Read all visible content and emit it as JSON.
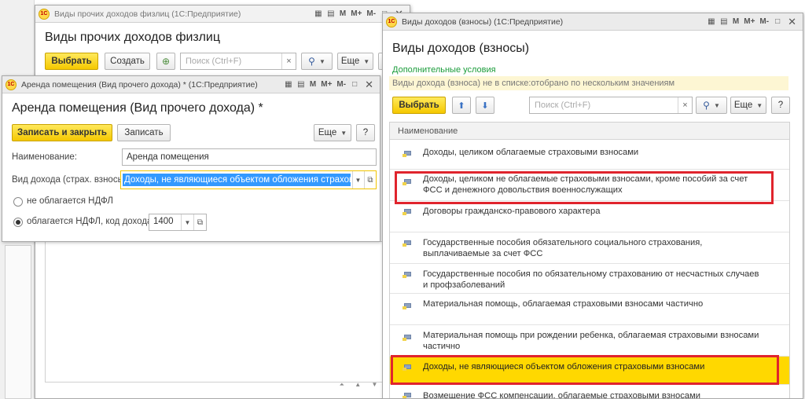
{
  "w1": {
    "title": "Виды прочих доходов физлиц  (1С:Предприятие)",
    "heading": "Виды прочих доходов физлиц",
    "select_btn": "Выбрать",
    "create_btn": "Создать",
    "search_placeholder": "Поиск (Ctrl+F)",
    "more_btn": "Еще",
    "help_btn": "?"
  },
  "w2": {
    "title": "Аренда помещения (Вид прочего дохода) *  (1С:Предприятие)",
    "heading": "Аренда помещения (Вид прочего дохода) *",
    "save_close_btn": "Записать и закрыть",
    "save_btn": "Записать",
    "more_btn": "Еще",
    "help_btn": "?",
    "name_label": "Наименование:",
    "name_value": "Аренда помещения",
    "income_type_label": "Вид дохода (страх. взносы):",
    "income_type_value": "Доходы, не являющиеся объектом обложения страховыми взносами",
    "radio_no_ndfl": "не облагается НДФЛ",
    "radio_ndfl": "облагается НДФЛ, код дохода:",
    "income_code": "1400"
  },
  "w3": {
    "title": "Виды доходов (взносы)  (1С:Предприятие)",
    "heading": "Виды доходов (взносы)",
    "extra_conditions": "Дополнительные условия",
    "filter_info": "Виды дохода (взноса) не в списке:отобрано по нескольким значениям",
    "select_btn": "Выбрать",
    "search_placeholder": "Поиск (Ctrl+F)",
    "more_btn": "Еще",
    "help_btn": "?",
    "column_header": "Наименование",
    "rows": [
      "Доходы, целиком облагаемые страховыми взносами",
      "Доходы, целиком не облагаемые страховыми взносами, кроме пособий за счет ФСС и денежного довольствия военнослужащих",
      "Договоры гражданско-правового характера",
      "Государственные пособия обязательного социального страхования, выплачиваемые за счет ФСС",
      "Государственные пособия по обязательному страхованию от несчастных случаев и профзаболеваний",
      "Материальная помощь, облагаемая страховыми взносами частично",
      "Материальная помощь при рождении ребенка, облагаемая страховыми взносами частично",
      "Доходы, не являющиеся объектом обложения страховыми взносами",
      "Возмещение ФСС компенсации, облагаемые страховыми взносами"
    ]
  },
  "title_icons": {
    "m": "M",
    "m_plus": "M+",
    "m_minus": "M-"
  },
  "colors": {
    "accent_yellow": "#f5c800",
    "highlight_row": "#ffd800",
    "selection_blue": "#3399ff",
    "annotation_red": "#e0242d",
    "green_link": "#1a9c3a"
  }
}
